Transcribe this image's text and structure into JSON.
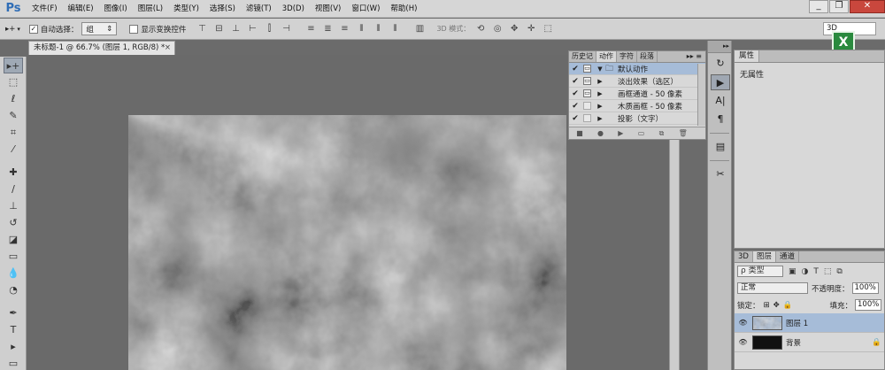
{
  "app": {
    "logo": "Ps"
  },
  "menu": [
    "文件(F)",
    "编辑(E)",
    "图像(I)",
    "图层(L)",
    "类型(Y)",
    "选择(S)",
    "滤镜(T)",
    "3D(D)",
    "视图(V)",
    "窗口(W)",
    "帮助(H)"
  ],
  "window_controls": {
    "minimize": "_",
    "restore": "❐",
    "close": "✕"
  },
  "options": {
    "move_icon": "▸+",
    "auto_select_label": "自动选择：",
    "auto_select_value": "组",
    "transform_label": "显示变换控件",
    "mode3d_label": "3D 模式：",
    "workspace": "3D"
  },
  "document": {
    "tab_title": "未标题-1 @ 66.7% (图层 1, RGB/8) *",
    "close": "×"
  },
  "actions_panel": {
    "tabs": [
      "历史记",
      "动作",
      "字符",
      "段落"
    ],
    "active_tab": "动作",
    "menu_glyph": "▸▸ ≡",
    "rows": [
      {
        "check": "✔",
        "toggle": "▭",
        "arrow": "▼",
        "folder": "🗀",
        "label": "默认动作",
        "selected": true
      },
      {
        "check": "✔",
        "toggle": "▭",
        "arrow": "▶",
        "folder": "",
        "label": "淡出效果（选区）",
        "selected": false
      },
      {
        "check": "✔",
        "toggle": "▭",
        "arrow": "▶",
        "folder": "",
        "label": "画框通道 - 50 像素",
        "selected": false
      },
      {
        "check": "✔",
        "toggle": "",
        "arrow": "▶",
        "folder": "",
        "label": "木质画框 - 50 像素",
        "selected": false
      },
      {
        "check": "✔",
        "toggle": "",
        "arrow": "▶",
        "folder": "",
        "label": "投影（文字）",
        "selected": false
      }
    ],
    "footer_icons": [
      "stop-icon",
      "record-icon",
      "play-icon",
      "folder-icon",
      "new-action-icon",
      "delete-icon"
    ]
  },
  "properties_panel": {
    "tab": "属性",
    "body": "无属性"
  },
  "layers_panel": {
    "tabs": [
      "3D",
      "图层",
      "通道"
    ],
    "active_tab": "图层",
    "filter_kind": "ρ 类型",
    "blend_mode": "正常",
    "opacity_label": "不透明度：",
    "opacity_value": "100%",
    "lock_label": "锁定：",
    "fill_label": "填充：",
    "fill_value": "100%",
    "layers": [
      {
        "name": "图层 1",
        "selected": true,
        "visible": true
      },
      {
        "name": "背景",
        "selected": false,
        "visible": true
      }
    ]
  }
}
